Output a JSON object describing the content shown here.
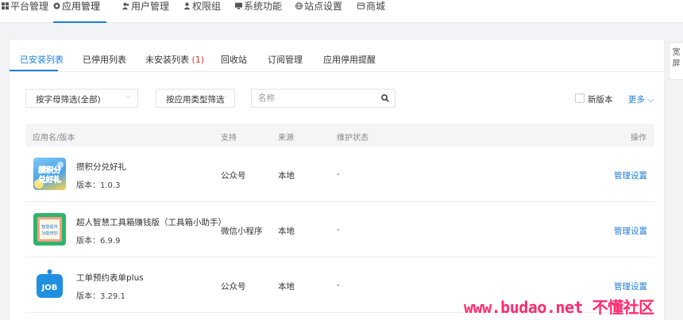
{
  "topnav": {
    "items": [
      {
        "label": "平台管理",
        "icon": "grid-icon"
      },
      {
        "label": "应用管理",
        "icon": "app-icon"
      },
      {
        "label": "用户管理",
        "icon": "users-icon"
      },
      {
        "label": "权限组",
        "icon": "permission-icon"
      },
      {
        "label": "系统功能",
        "icon": "monitor-icon"
      },
      {
        "label": "站点设置",
        "icon": "globe-icon"
      },
      {
        "label": "商城",
        "icon": "shop-icon"
      }
    ],
    "active_index": 1
  },
  "tabs": [
    {
      "label": "已安装列表",
      "count": ""
    },
    {
      "label": "已停用列表",
      "count": ""
    },
    {
      "label": "未安装列表",
      "count": "(1)"
    },
    {
      "label": "回收站",
      "count": ""
    },
    {
      "label": "订阅管理",
      "count": ""
    },
    {
      "label": "应用停用提醒",
      "count": ""
    }
  ],
  "filters": {
    "letter_select": "按字母筛选(全部)",
    "type_select": "按应用类型筛选",
    "search_placeholder": "名称",
    "new_version_label": "新版本",
    "more_label": "更多"
  },
  "table": {
    "headers": {
      "name": "应用名/版本",
      "support": "支持",
      "source": "来源",
      "status": "维护状态",
      "action": "操作"
    },
    "rows": [
      {
        "name": "攒积分兑好礼",
        "version": "版本：1.0.3",
        "support": "公众号",
        "source": "本地",
        "status": "-",
        "action": "管理设置",
        "icon_text": "攒积分兑好礼"
      },
      {
        "name": "超人智慧工具箱赚钱版（工具箱小助手）",
        "version": "版本：6.9.9",
        "support": "微信小程序",
        "source": "本地",
        "status": "-",
        "action": "管理设置",
        "icon_text": "智慧超市 功能增加"
      },
      {
        "name": "工单预约表单plus",
        "version": "版本：3.29.1",
        "support": "公众号",
        "source": "本地",
        "status": "-",
        "action": "管理设置",
        "icon_text": "JOB"
      }
    ]
  },
  "side_widget": {
    "label": "宽屏"
  },
  "watermark": "www.budao.net 不懂社区",
  "colors": {
    "accent": "#1e7fd8",
    "count_red": "#e0312f",
    "watermark": "#ff2a6f"
  }
}
